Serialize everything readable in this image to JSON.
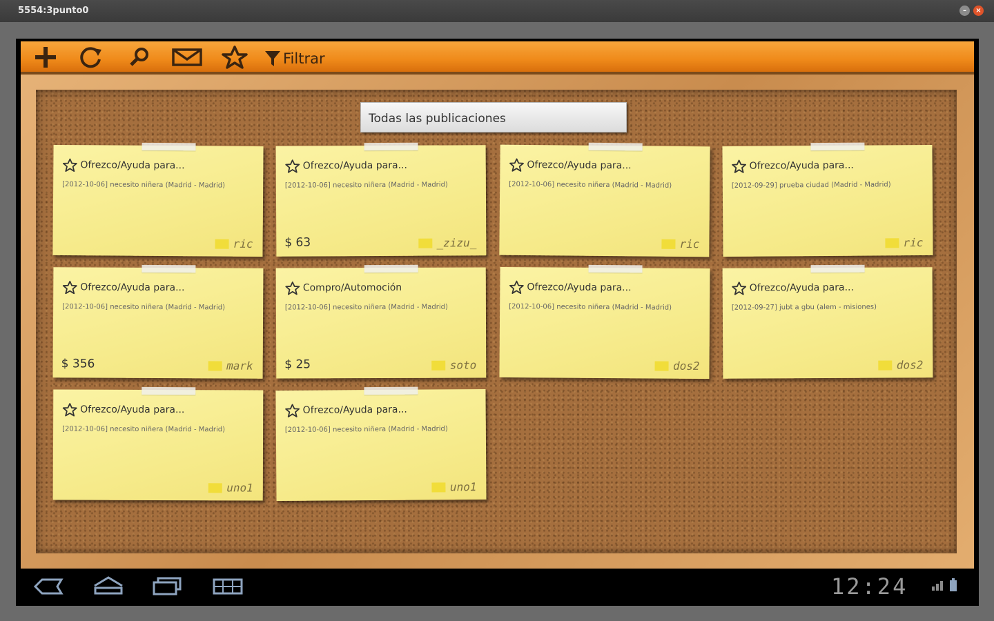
{
  "window": {
    "title": "5554:3punto0"
  },
  "toolbar": {
    "filter_label": "Filtrar"
  },
  "spinner": {
    "selected": "Todas las publicaciones"
  },
  "notes": [
    {
      "title": "Ofrezco/Ayuda para...",
      "desc": "[2012-10-06] necesito niñera (Madrid - Madrid)",
      "price": "",
      "user": "ric"
    },
    {
      "title": "Ofrezco/Ayuda para...",
      "desc": "[2012-10-06] necesito niñera (Madrid - Madrid)",
      "price": "$ 63",
      "user": "_zizu_"
    },
    {
      "title": "Ofrezco/Ayuda para...",
      "desc": "[2012-10-06] necesito niñera (Madrid - Madrid)",
      "price": "",
      "user": "ric"
    },
    {
      "title": "Ofrezco/Ayuda para...",
      "desc": "[2012-09-29] prueba ciudad (Madrid - Madrid)",
      "price": "",
      "user": "ric"
    },
    {
      "title": "Ofrezco/Ayuda para...",
      "desc": "[2012-10-06] necesito niñera (Madrid - Madrid)",
      "price": "$ 356",
      "user": "mark"
    },
    {
      "title": "Compro/Automoción",
      "desc": "[2012-10-06] necesito niñera (Madrid - Madrid)",
      "price": "$ 25",
      "user": "soto"
    },
    {
      "title": "Ofrezco/Ayuda para...",
      "desc": "[2012-10-06] necesito niñera (Madrid - Madrid)",
      "price": "",
      "user": "dos2"
    },
    {
      "title": "Ofrezco/Ayuda para...",
      "desc": "[2012-09-27] jubt a gbu (alem - misiones)",
      "price": "",
      "user": "dos2"
    },
    {
      "title": "Ofrezco/Ayuda para...",
      "desc": "[2012-10-06] necesito niñera (Madrid - Madrid)",
      "price": "",
      "user": "uno1"
    },
    {
      "title": "Ofrezco/Ayuda para...",
      "desc": "[2012-10-06] necesito niñera (Madrid - Madrid)",
      "price": "",
      "user": "uno1"
    }
  ],
  "statusbar": {
    "clock": "12:24"
  },
  "colors": {
    "toolbar": "#ef8a1a",
    "cork": "#a56f3e",
    "note": "#f6eb8c",
    "user_badge": "#f1dd3a"
  },
  "icons": {
    "toolbar": [
      "add-icon",
      "refresh-icon",
      "search-icon",
      "mail-icon",
      "star-icon",
      "filter-icon"
    ],
    "nav": [
      "back-icon",
      "home-icon",
      "recent-apps-icon",
      "menu-grid-icon"
    ]
  }
}
